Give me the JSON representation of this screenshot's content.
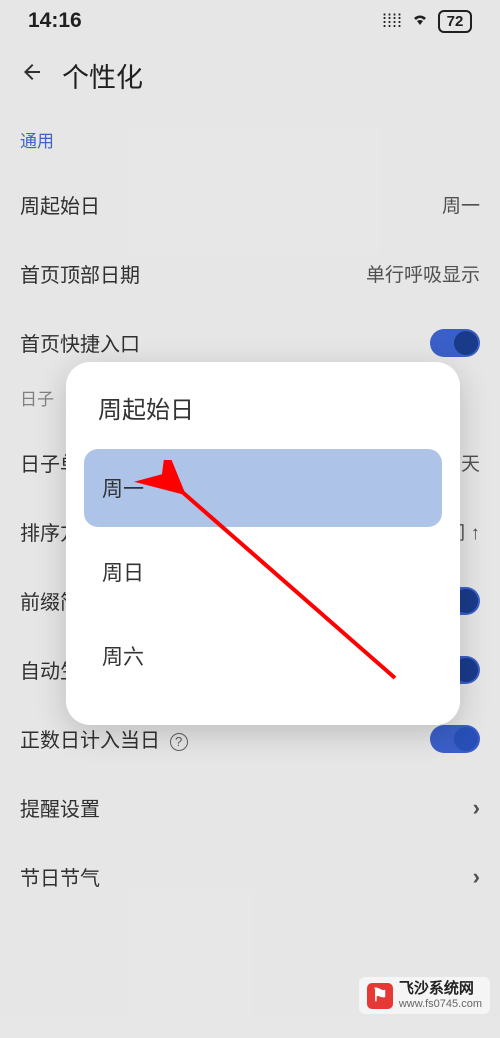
{
  "statusbar": {
    "time": "14:16",
    "battery": "72"
  },
  "header": {
    "title": "个性化"
  },
  "sections": {
    "general_label": "通用",
    "days_label": "日子"
  },
  "rows": {
    "week_start": {
      "label": "周起始日",
      "value": "周一"
    },
    "home_top_date": {
      "label": "首页顶部日期",
      "value": "单行呼吸显示"
    },
    "home_shortcut": {
      "label": "首页快捷入口"
    },
    "day_unit": {
      "label": "日子单",
      "value": "年月天"
    },
    "sort": {
      "label": "排序方",
      "value": "时间 ↑"
    },
    "prefix": {
      "label": "前缀简"
    },
    "auto_gen": {
      "label": "自动生"
    },
    "positive_day": {
      "label": "正数日计入当日"
    },
    "reminder": {
      "label": "提醒设置"
    },
    "festival": {
      "label": "节日节气"
    }
  },
  "dialog": {
    "title": "周起始日",
    "options": {
      "mon": "周一",
      "sun": "周日",
      "sat": "周六"
    }
  },
  "watermark": {
    "name": "飞沙系统网",
    "url": "www.fs0745.com"
  }
}
